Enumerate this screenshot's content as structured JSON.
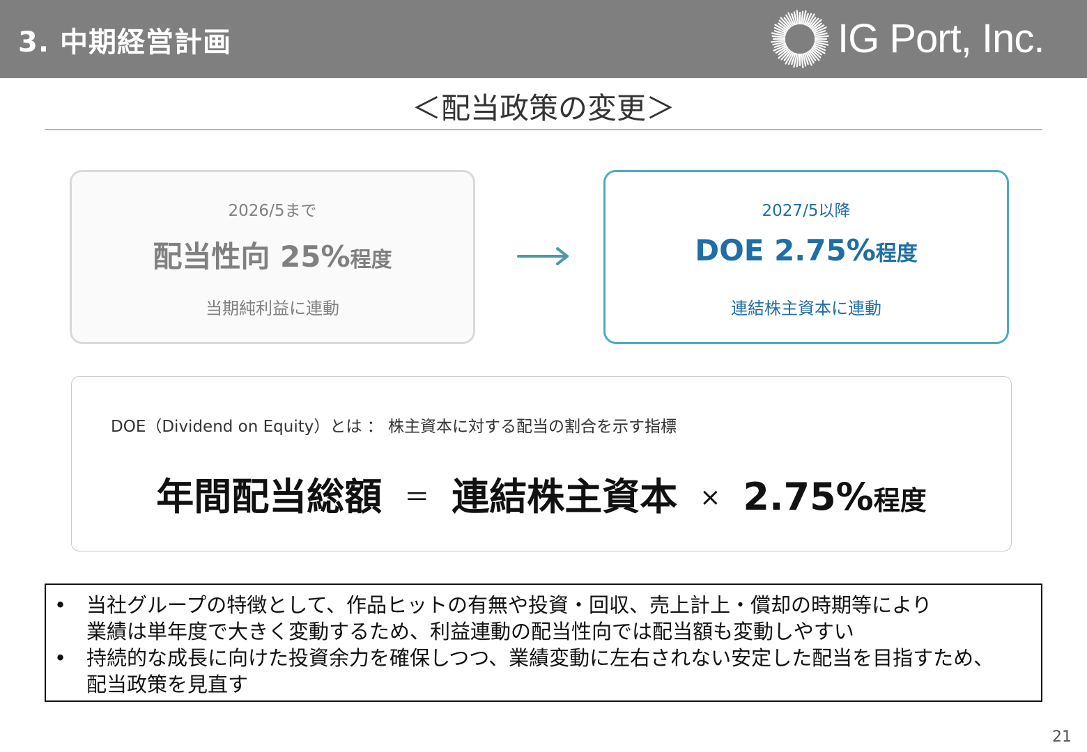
{
  "header": {
    "title": "3. 中期経営計画",
    "logo_text": "IG Port, Inc."
  },
  "subtitle": "＜配当政策の変更＞",
  "before": {
    "period": "2026/5まで",
    "main": "配当性向 25%",
    "suffix": "程度",
    "note": "当期純利益に連動"
  },
  "after": {
    "period": "2027/5以降",
    "main": "DOE 2.75%",
    "suffix": "程度",
    "note": "連結株主資本に連動"
  },
  "formula": {
    "definition": "DOE（Dividend on Equity）とは ： 株主資本に対する配当の割合を示す指標",
    "left": "年間配当総額",
    "equals": "＝",
    "middle": "連結株主資本",
    "times": "×",
    "right": "2.75%",
    "suffix": "程度"
  },
  "notes": [
    {
      "bullet": "•",
      "line1": "当社グループの特徴として、作品ヒットの有無や投資・回収、売上計上・償却の時期等により",
      "line2": "業績は単年度で大きく変動するため、利益連動の配当性向では配当額も変動しやすい"
    },
    {
      "bullet": "•",
      "line1": "持続的な成長に向けた投資余力を確保しつつ、業績変動に左右されない安定した配当を目指すため、",
      "line2": "配当政策を見直す"
    }
  ],
  "page_number": "21",
  "colors": {
    "header_bg": "#7f7f7f",
    "accent_teal": "#4bacc0",
    "accent_blue": "#1f6ea5",
    "muted_gray": "#808080"
  },
  "icons": {
    "logo": "sunburst-ring-icon",
    "arrow": "right-arrow-icon"
  }
}
